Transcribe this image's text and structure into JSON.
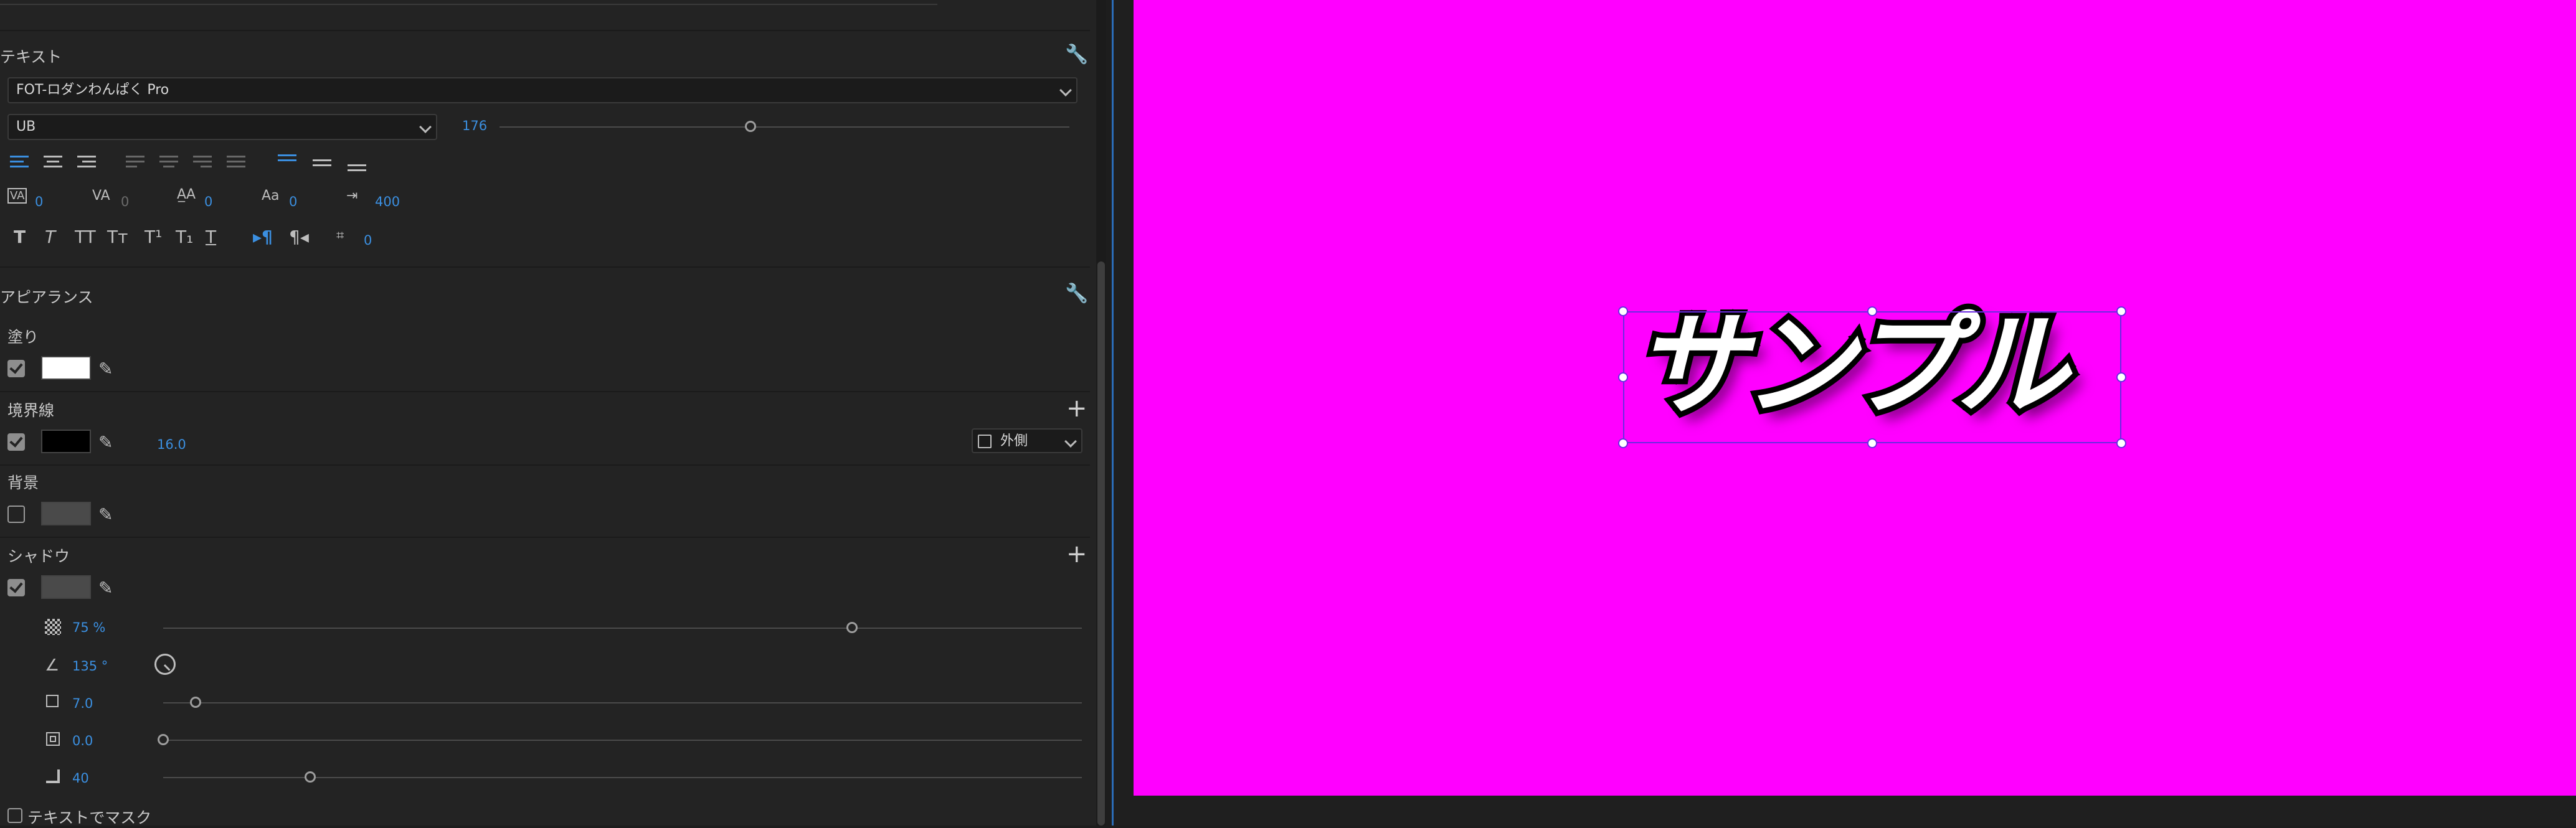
{
  "colors": {
    "canvas_bg": "#ff00ff",
    "accent": "#3b8fe0",
    "fill": "#ffffff",
    "stroke": "#000000",
    "selection": "#6b2be0"
  },
  "text_section": {
    "header": "テキスト",
    "font_family": "FOT-ロダンわんぱく Pro",
    "font_style": "UB",
    "font_size": "176",
    "font_size_slider": 0.44,
    "kerning": "0",
    "tracking": "0",
    "leading": "0",
    "baseline_shift": "0",
    "tab_width": "400",
    "tsume": "0"
  },
  "appearance": {
    "header": "アピアランス",
    "fill": {
      "label": "塗り",
      "checked": true
    },
    "stroke": {
      "label": "境界線",
      "checked": true,
      "width": "16.0",
      "position": "外側"
    },
    "background": {
      "label": "背景",
      "checked": false
    },
    "shadow": {
      "label": "シャドウ",
      "checked": true,
      "opacity": "75 %",
      "opacity_level": 0.75,
      "angle": "135 °",
      "distance": "7.0",
      "distance_level": 0.035,
      "size": "0.0",
      "size_level": 0.0,
      "blur": "40",
      "blur_level": 0.16
    },
    "mask_label": "テキストでマスク"
  },
  "canvas": {
    "text": "サンプル"
  }
}
